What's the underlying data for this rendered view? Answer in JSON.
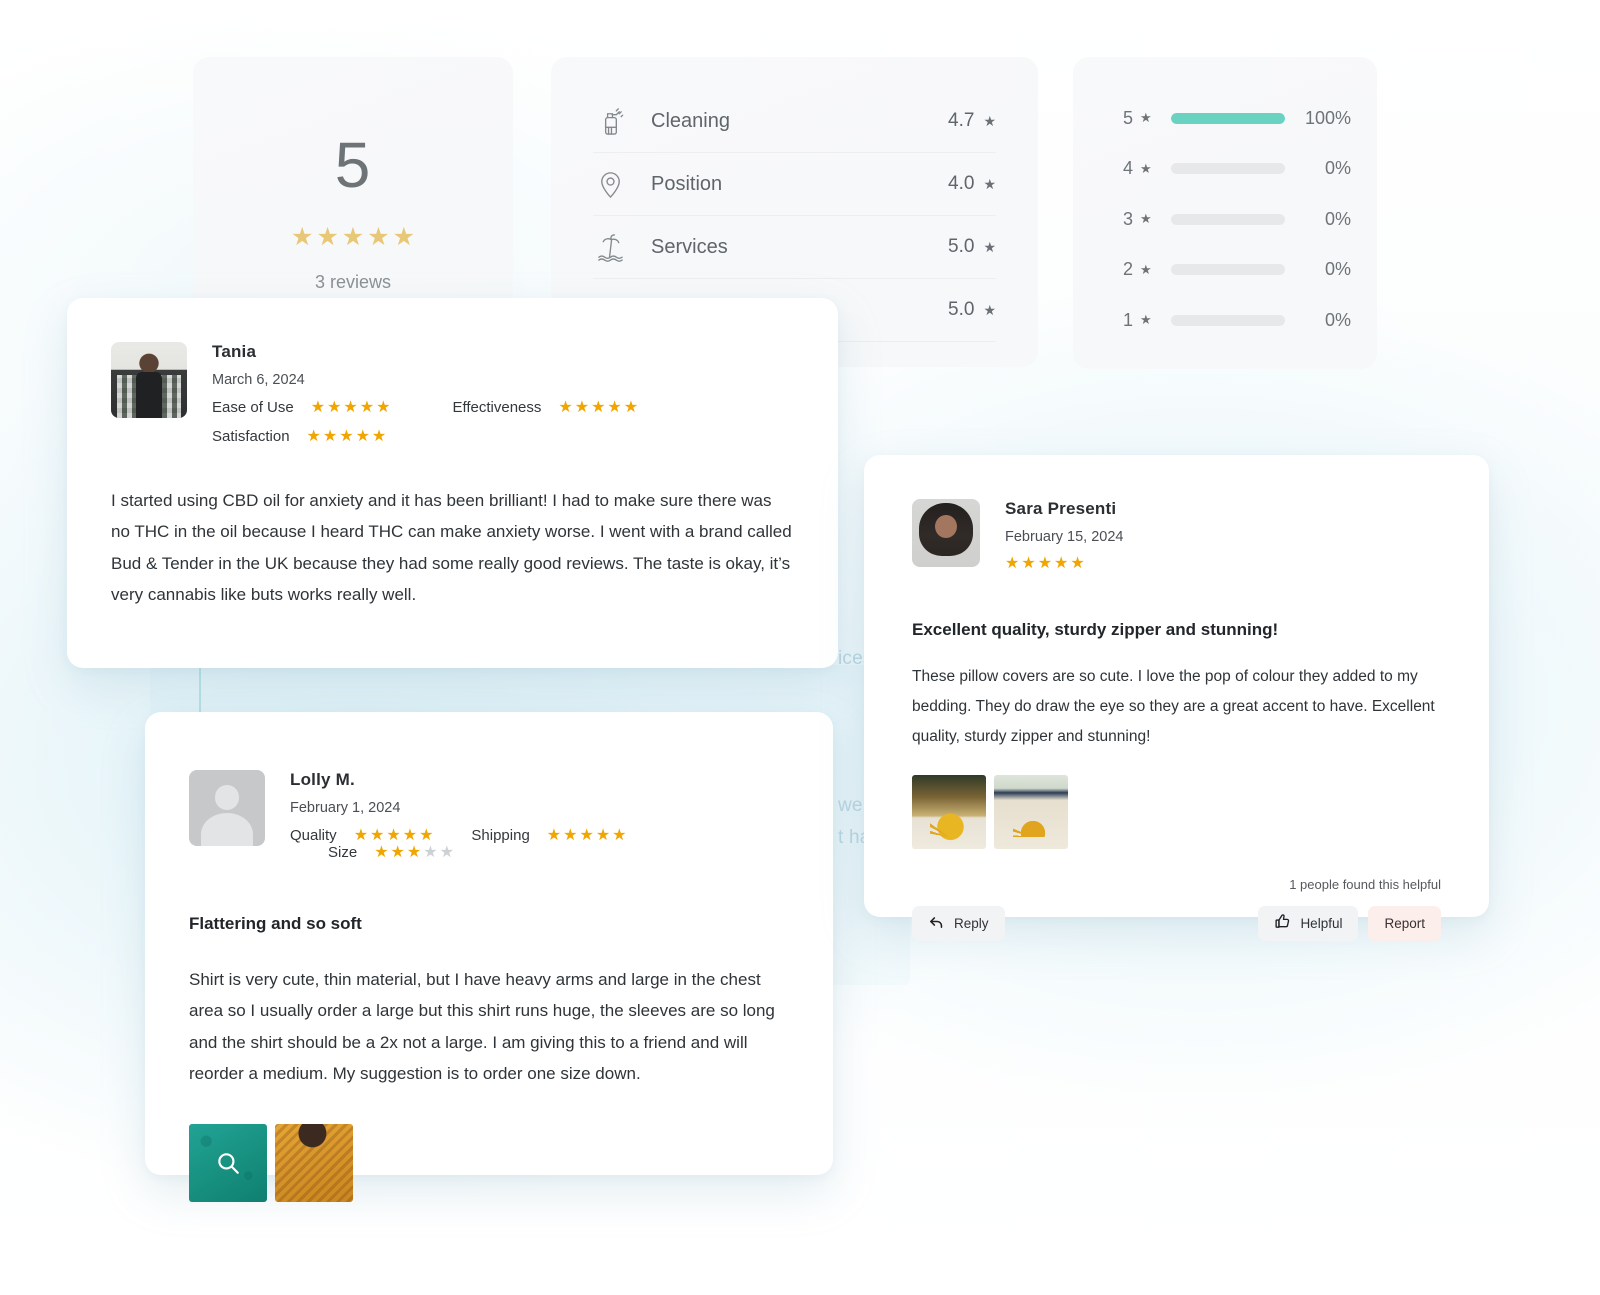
{
  "background": {
    "ghost_text_1": "ices",
    "ghost_text_2": "well",
    "ghost_text_3": "t ha"
  },
  "summary": {
    "score": "5",
    "stars": 5,
    "reviews_count": "3 reviews"
  },
  "category_ratings": {
    "rows": [
      {
        "icon": "spray-bottle-icon",
        "label": "Cleaning",
        "value": "4.7"
      },
      {
        "icon": "location-pin-icon",
        "label": "Position",
        "value": "4.0"
      },
      {
        "icon": "palm-beach-icon",
        "label": "Services",
        "value": "5.0"
      },
      {
        "icon": "hidden-icon",
        "label": "",
        "value": "5.0"
      }
    ],
    "star_glyph": "★"
  },
  "distribution": {
    "rows": [
      {
        "stars": "5",
        "percent": "100%",
        "fill": 100
      },
      {
        "stars": "4",
        "percent": "0%",
        "fill": 0
      },
      {
        "stars": "3",
        "percent": "0%",
        "fill": 0
      },
      {
        "stars": "2",
        "percent": "0%",
        "fill": 0
      },
      {
        "stars": "1",
        "percent": "0%",
        "fill": 0
      }
    ],
    "bar_color": "#69d2c0",
    "track_color": "#e6e8ea"
  },
  "reviews": {
    "tania": {
      "name": "Tania",
      "date": "March 6, 2024",
      "ratings": [
        {
          "label": "Ease of Use",
          "filled": 5,
          "total": 5
        },
        {
          "label": "Effectiveness",
          "filled": 5,
          "total": 5
        },
        {
          "label": "Satisfaction",
          "filled": 5,
          "total": 5
        }
      ],
      "body": "I started using CBD oil for anxiety and it has been brilliant! I had to make sure there was no THC in the oil because I heard THC can make anxiety worse. I went with a brand called Bud & Tender in the UK because they had some really good reviews. The taste is okay, it’s very cannabis like buts works really well."
    },
    "lolly": {
      "name": "Lolly M.",
      "date": "February 1, 2024",
      "ratings": [
        {
          "label": "Quality",
          "filled": 5,
          "total": 5
        },
        {
          "label": "Shipping",
          "filled": 5,
          "total": 5
        },
        {
          "label": "Size",
          "filled": 3,
          "total": 5
        }
      ],
      "title": "Flattering and so soft",
      "body": "Shirt is very cute, thin material, but I have heavy arms and large in the chest area so I usually order a large but this shirt runs huge, the sleeves are so long and the shirt should be a 2x not a large. I am giving this to a friend and will reorder a medium. My suggestion is to order one size down.",
      "photos": [
        {
          "name": "teal-shirt-photo",
          "overlay_icon": "magnifier-icon"
        },
        {
          "name": "gold-dress-photo",
          "overlay_icon": ""
        }
      ]
    },
    "sara": {
      "name": "Sara Presenti",
      "date": "February 15, 2024",
      "stars": 5,
      "title": "Excellent quality, sturdy zipper and stunning!",
      "body": "These pillow covers are so cute. I love the pop of colour they added to my bedding. They do draw the eye so they are a great accent to have. Excellent quality, sturdy zipper and stunning!",
      "photos": [
        {
          "name": "pillow-photo-1"
        },
        {
          "name": "pillow-photo-2"
        }
      ],
      "helpful_count": "1 people found this helpful",
      "buttons": {
        "reply": "Reply",
        "helpful": "Helpful",
        "report": "Report"
      }
    }
  },
  "colors": {
    "star_gold": "#f0a500",
    "star_gold_light": "#e8c776",
    "star_off": "#cdd1d4",
    "accent_teal": "#69d2c0",
    "report_bg": "#fceeea"
  }
}
